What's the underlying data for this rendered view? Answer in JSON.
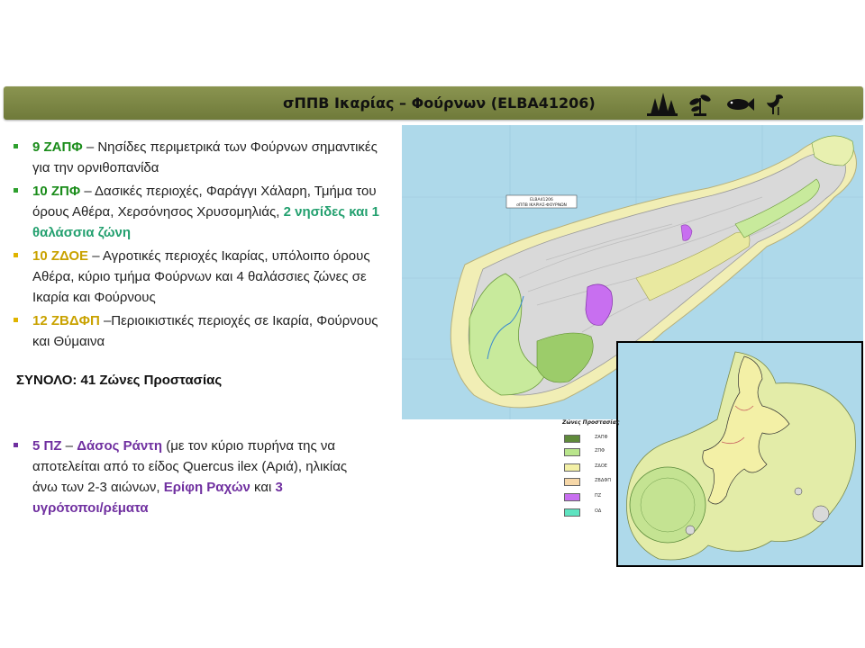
{
  "title": "σΠΠΒ Ικαρίας – Φούρνων (ELBA41206)",
  "icons": [
    "forest-icon",
    "plant-icon",
    "fish-icon",
    "bird-icon"
  ],
  "colors": {
    "title_bar": "#7a8444",
    "green": "#1a8c1a",
    "teal": "#23a06f",
    "gold": "#c9a200",
    "purple": "#7030a0"
  },
  "bullets": [
    {
      "code": "9 ΖΑΠΦ",
      "text": " – Νησίδες περιμετρικά των Φούρνων σημαντικές για την ορνιθοπανίδα"
    },
    {
      "code": "10 ΖΠΦ",
      "text": " – Δασικές περιοχές, Φαράγγι Χάλαρη, Τμήμα του όρους Αθέρα, Χερσόνησος Χρυσομηλιάς, ",
      "highlight": "2 νησίδες και 1 θαλάσσια ζώνη"
    },
    {
      "code": "10 ΖΔΟΕ",
      "text": " – Αγροτικές περιοχές Ικαρίας, υπόλοιπο όρους Αθέρα, κύριο τμήμα Φούρνων και 4 θαλάσσιες ζώνες σε Ικαρία και Φούρνους"
    },
    {
      "code": "12 ΖΒΔΦΠ",
      "text": " –Περιοικιστικές περιοχές σε Ικαρία, Φούρνους και Θύμαινα"
    }
  ],
  "total": "ΣΥΝΟΛΟ: 41 Ζώνες Προστασίας",
  "pz": {
    "code": "5 ΠΖ",
    "dash": " – ",
    "forest": "Δάσος Ράντη",
    "text1": " (με τον κύριο πυρήνα της να αποτελείται από το είδος Quercus ilex (Αριά), ηλικίας άνω των 2-3 αιώνων, ",
    "erifi": "Ερίφη Ραχών",
    "and": " και ",
    "wetlands": "3 υγρότοποι/ρέματα"
  },
  "map": {
    "label_line1": "ELBA41206",
    "label_line2": "σΠΠΒ ΙΚΑΡΙΑΣ-ΦΟΥΡΝΩΝ"
  },
  "legend": {
    "title": "Ζώνες Προστασίας",
    "items": [
      {
        "label": "ΖΑΠΦ",
        "color": "#5f8a3a"
      },
      {
        "label": "ΖΠΦ",
        "color": "#b9e58c"
      },
      {
        "label": "ΖΔΟΕ",
        "color": "#f3f0a6"
      },
      {
        "label": "ΖΒΔΦΠ",
        "color": "#f6d7a8"
      },
      {
        "label": "ΠΖ",
        "color": "#c86ff0"
      },
      {
        "label": "ΟΔ",
        "color": "#5ee3c0"
      }
    ]
  }
}
